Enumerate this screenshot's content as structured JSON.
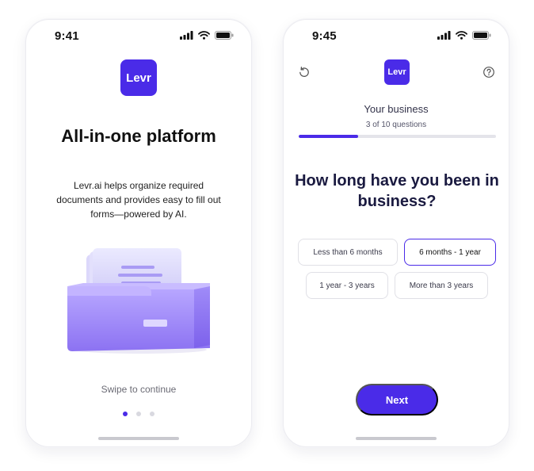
{
  "theme": {
    "accent": "#4a2be8",
    "muted_track": "#e4e4ea",
    "dot_inactive": "#d9d9e0"
  },
  "left_screen": {
    "status": {
      "time": "9:41",
      "icons": [
        "signal-icon",
        "wifi-icon",
        "battery-icon"
      ]
    },
    "logo": "Levr",
    "headline": "All-in-one platform",
    "description": "Levr.ai helps organize required documents and provides easy to fill out forms—powered by AI.",
    "illustration": "file-drawer-illustration",
    "swipe_hint": "Swipe to continue",
    "pagination": {
      "total": 3,
      "active": 1
    }
  },
  "right_screen": {
    "status": {
      "time": "9:45",
      "icons": [
        "signal-icon",
        "wifi-icon",
        "battery-icon"
      ]
    },
    "header": {
      "left_icon": "refresh-icon",
      "logo": "Levr",
      "right_icon": "help-icon"
    },
    "section_title": "Your business",
    "progress": {
      "label": "3 of 10 questions",
      "current": 3,
      "total": 10
    },
    "question": "How long have you been in business?",
    "options": [
      {
        "label": "Less than 6 months",
        "selected": false
      },
      {
        "label": "6 months - 1 year",
        "selected": true
      },
      {
        "label": "1 year - 3 years",
        "selected": false
      },
      {
        "label": "More than 3 years",
        "selected": false
      }
    ],
    "next_label": "Next"
  }
}
